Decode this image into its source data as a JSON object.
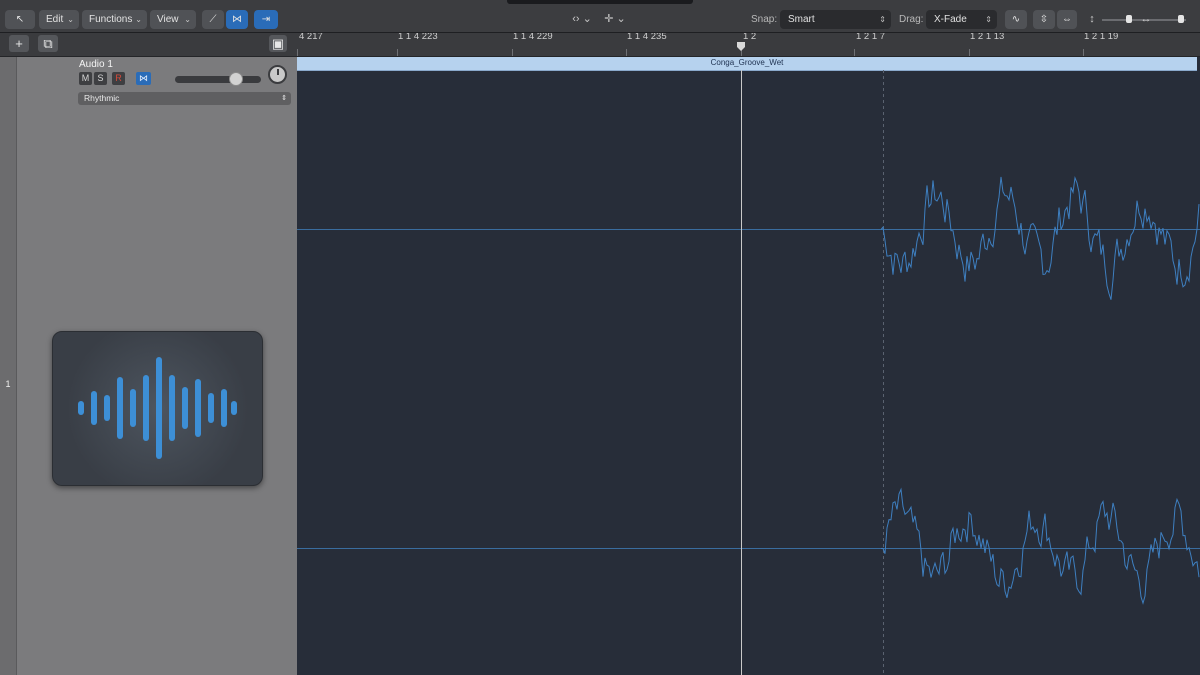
{
  "toolbar": {
    "edit_label": "Edit",
    "functions_label": "Functions",
    "view_label": "View",
    "snap_label": "Snap:",
    "snap_value": "Smart",
    "drag_label": "Drag:",
    "drag_value": "X-Fade"
  },
  "ruler": {
    "ticks": [
      "4 217",
      "1 1 4 223",
      "1 1 4 229",
      "1 1 4 235",
      "1 2",
      "1 2 1 7",
      "1 2 1 13",
      "1 2 1 19"
    ]
  },
  "track": {
    "number": "1",
    "name": "Audio 1",
    "mute_label": "M",
    "solo_label": "S",
    "record_label": "R",
    "preset": "Rhythmic"
  },
  "region": {
    "name": "Conga_Groove_Wet",
    "color": "#b6d2ee"
  },
  "colors": {
    "waveform": "#3e7fc0",
    "arrange_bg": "#272d39",
    "accent": "#2a6cb8"
  }
}
